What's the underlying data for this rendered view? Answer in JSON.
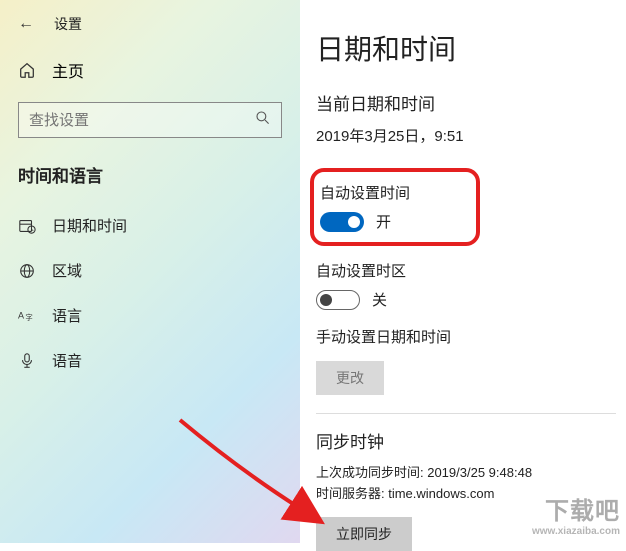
{
  "header": {
    "settings_label": "设置"
  },
  "sidebar": {
    "home_label": "主页",
    "search_placeholder": "查找设置",
    "section_label": "时间和语言",
    "items": [
      {
        "label": "日期和时间"
      },
      {
        "label": "区域"
      },
      {
        "label": "语言"
      },
      {
        "label": "语音"
      }
    ]
  },
  "main": {
    "title": "日期和时间",
    "current_label": "当前日期和时间",
    "current_value": "2019年3月25日，9:51",
    "auto_time_label": "自动设置时间",
    "auto_time_state": "开",
    "auto_tz_label": "自动设置时区",
    "auto_tz_state": "关",
    "manual_label": "手动设置日期和时间",
    "change_btn": "更改",
    "sync_title": "同步时钟",
    "last_sync": "上次成功同步时间: 2019/3/25 9:48:48",
    "server": "时间服务器: time.windows.com",
    "sync_btn": "立即同步"
  },
  "watermark": {
    "line1": "下载吧",
    "line2": "www.xiazaiba.com"
  }
}
